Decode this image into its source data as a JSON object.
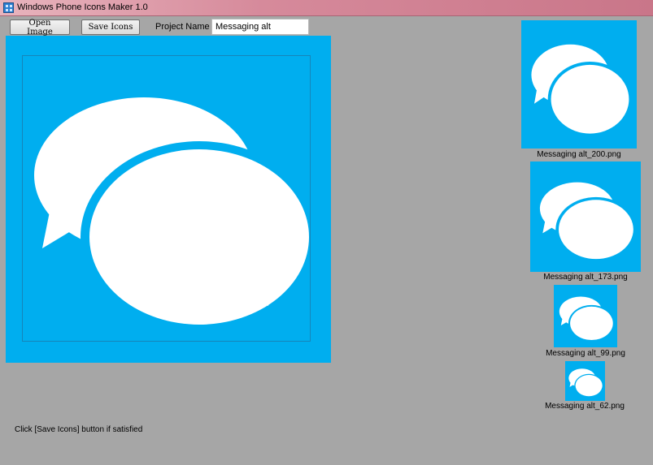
{
  "window": {
    "title": "Windows Phone Icons Maker 1.0"
  },
  "toolbar": {
    "open_label": "Open Image",
    "save_label": "Save Icons",
    "project_label": "Project Name",
    "project_value": "Messaging alt"
  },
  "canvas": {
    "icon": "messaging-bubbles-icon",
    "background_color": "#00aeef"
  },
  "previews": [
    {
      "label": "Messaging alt_200.png"
    },
    {
      "label": "Messaging alt_173.png"
    },
    {
      "label": "Messaging alt_99.png"
    },
    {
      "label": "Messaging alt_62.png"
    }
  ],
  "status": {
    "message": "Click [Save Icons] button if satisfied"
  }
}
